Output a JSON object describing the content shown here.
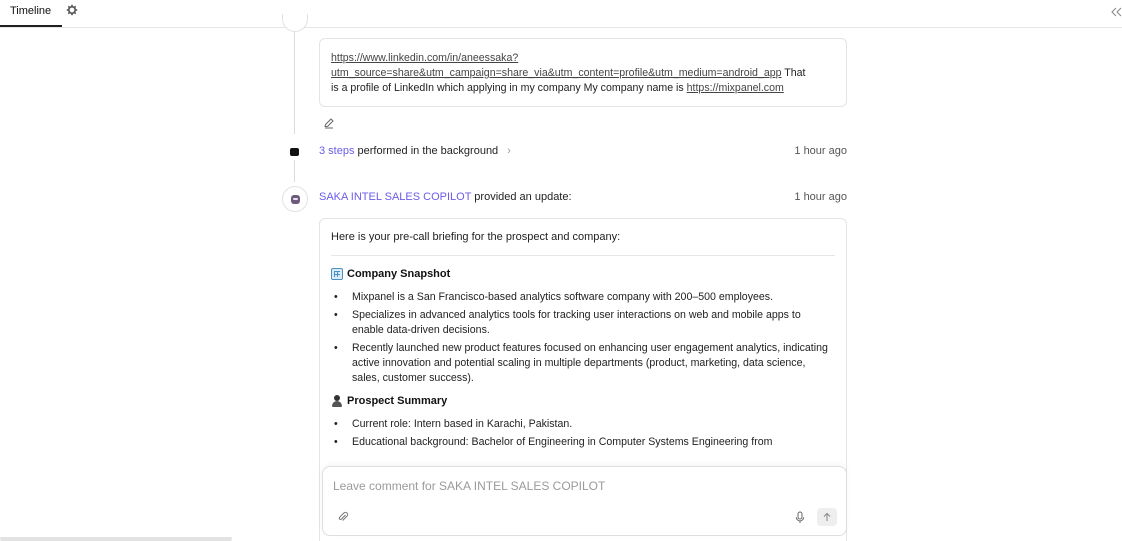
{
  "tabs": {
    "active_label": "Timeline"
  },
  "icons": {
    "settings": "gear-icon",
    "collapse": "double-chevron-left-icon",
    "edit": "pencil-icon",
    "attach": "paperclip-icon",
    "mic": "microphone-icon",
    "send": "arrow-up-icon"
  },
  "message1": {
    "link1": "https://www.linkedin.com/in/aneessaka?",
    "link1_cont": "utm_source=share&utm_campaign=share_via&utm_content=profile&utm_medium=android_app",
    "text1": " That",
    "text2": "is a profile of LinkedIn which applying in my company My company name is ",
    "link2": "https://mixpanel.com"
  },
  "steps": {
    "count_label": "3 steps",
    "rest_label": "performed in the background",
    "chevron": "›",
    "time": "1 hour ago"
  },
  "update": {
    "agent": "SAKA INTEL SALES COPILOT",
    "action": "provided an update:",
    "time": "1 hour ago"
  },
  "briefing": {
    "intro": "Here is your pre-call briefing for the prospect and company:",
    "company_title": "Company Snapshot",
    "company_bullets": [
      "Mixpanel is a San Francisco-based analytics software company with 200–500 employees.",
      "Specializes in advanced analytics tools for tracking user interactions on web and mobile apps to enable data-driven decisions.",
      "Recently launched new product features focused on enhancing user engagement analytics, indicating active innovation and potential scaling in multiple departments (product, marketing, data science, sales, customer success)."
    ],
    "prospect_title": "Prospect Summary",
    "prospect_bullets": [
      "Current role: Intern based in Karachi, Pakistan.",
      "Educational background: Bachelor of Engineering in Computer Systems Engineering from"
    ]
  },
  "composer": {
    "placeholder": "Leave comment for SAKA INTEL SALES COPILOT"
  },
  "colors": {
    "accent": "#6b5ce7",
    "border": "#e4e4e4",
    "text": "#222222",
    "muted": "#555555"
  }
}
